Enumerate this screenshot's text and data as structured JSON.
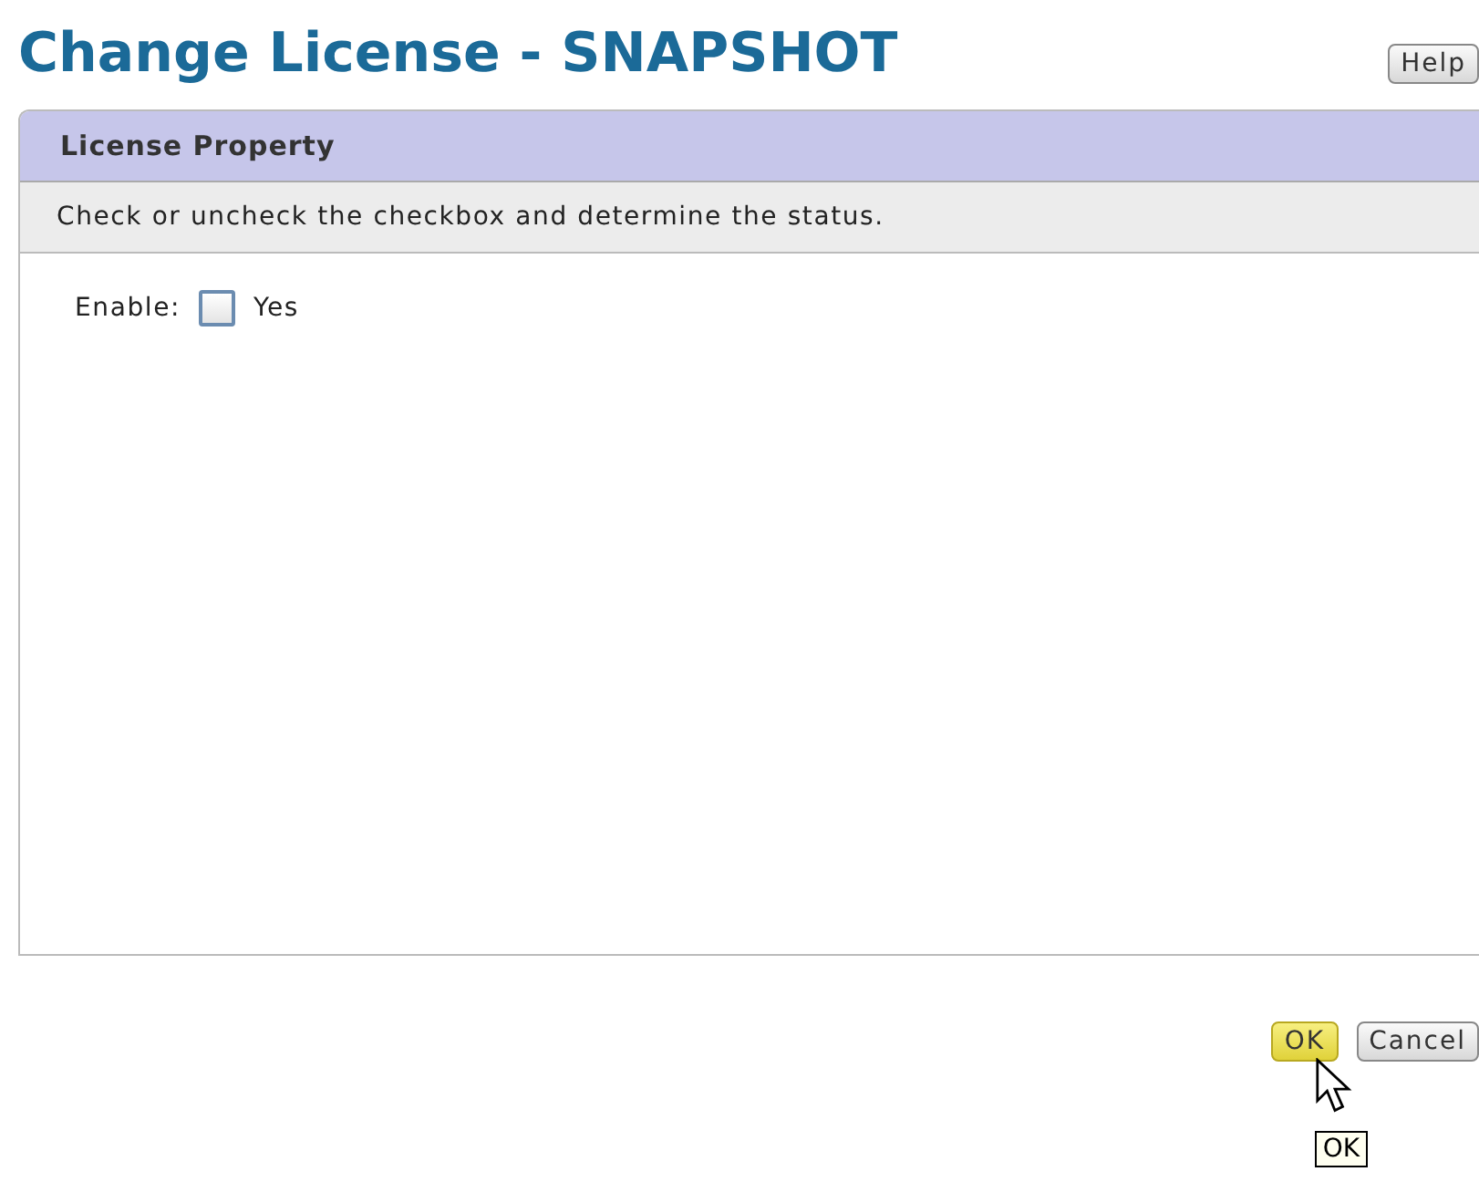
{
  "page": {
    "title": "Change License - SNAPSHOT",
    "help_button": "Help"
  },
  "panel": {
    "title": "License Property",
    "instructions": "Check or uncheck the checkbox and determine the status.",
    "fields": [
      {
        "label": "Enable:",
        "option": "Yes",
        "checked": false
      }
    ]
  },
  "buttons": [
    {
      "label": "OK",
      "hovered": true
    },
    {
      "label": "Cancel",
      "hovered": false
    }
  ],
  "tooltip": "OK"
}
